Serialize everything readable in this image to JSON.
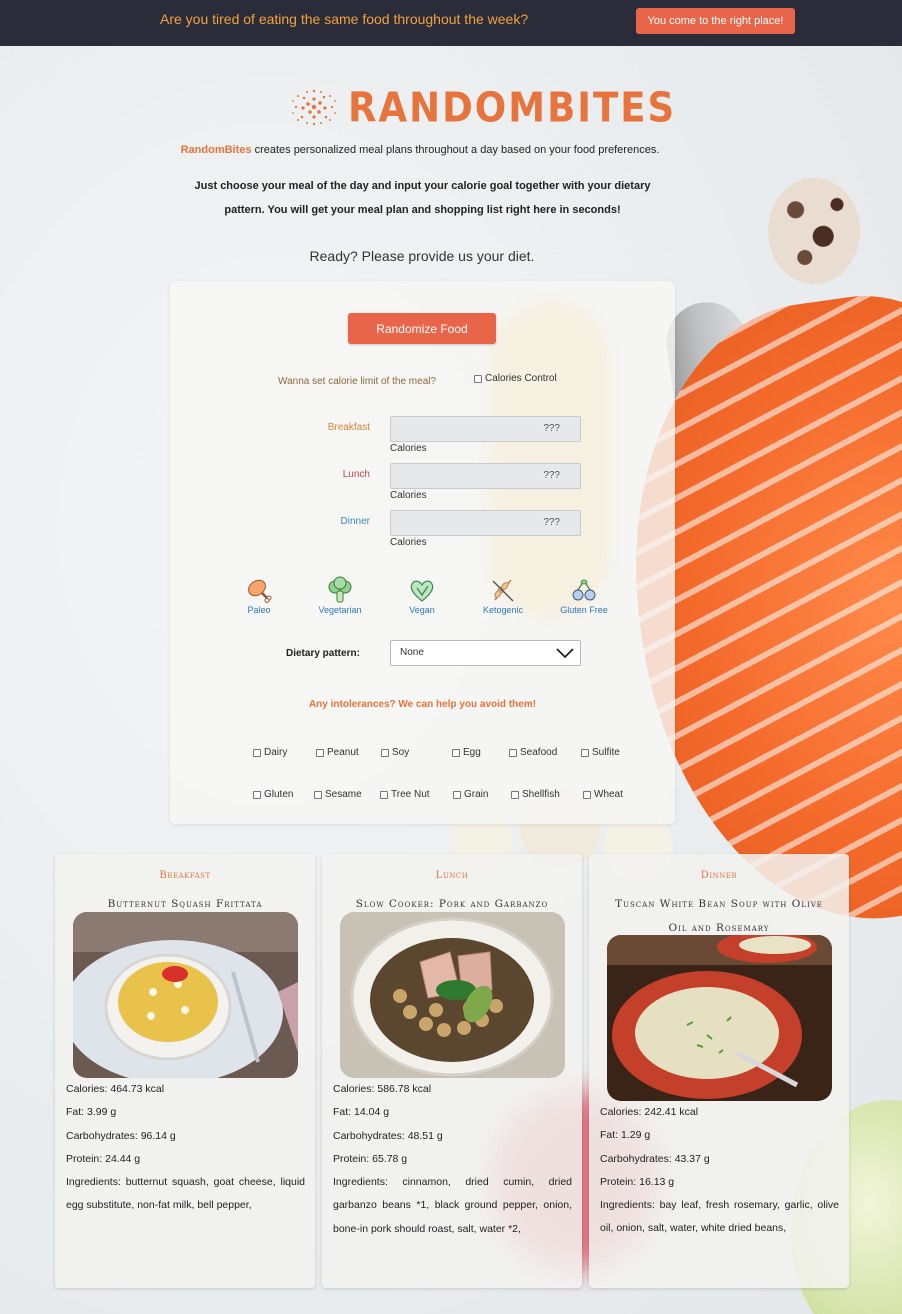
{
  "topbar": {
    "question": "Are you tired of eating the same food throughout the week?",
    "cta_label": "You come to the right place!"
  },
  "brand": {
    "logo_text": "RANDOMBITES",
    "name": "RandomBites",
    "accent": "#e6743c"
  },
  "intro": {
    "line1_rest": "creates personalized meal plans throughout a day based on your food preferences.",
    "line2": "Just choose your meal of the day and input your calorie goal together with your dietary pattern. You will get your meal plan and shopping list right here in seconds!",
    "ready": "Ready? Please provide us your diet."
  },
  "form": {
    "randomize_label": "Randomize Food",
    "calorie_question": "Wanna set calorie limit of the meal?",
    "calorie_control_label": "Calories Control",
    "meals": [
      {
        "label": "Breakfast",
        "value": "???",
        "unit": "Calories",
        "color": "#d8873a"
      },
      {
        "label": "Lunch",
        "value": "???",
        "unit": "Calories",
        "color": "#b84a4a"
      },
      {
        "label": "Dinner",
        "value": "???",
        "unit": "Calories",
        "color": "#3a87c8"
      }
    ],
    "diets": [
      {
        "label": "Paleo",
        "icon": "drumstick-icon"
      },
      {
        "label": "Vegetarian",
        "icon": "broccoli-icon"
      },
      {
        "label": "Vegan",
        "icon": "heart-leaf-icon"
      },
      {
        "label": "Ketogenic",
        "icon": "no-wheat-icon"
      },
      {
        "label": "Gluten Free",
        "icon": "grains-icon"
      }
    ],
    "dietary_pattern_label": "Dietary pattern:",
    "dietary_pattern_value": "None",
    "intolerance_question": "Any intolerances? We can help you avoid them!",
    "intolerances": [
      "Dairy",
      "Peanut",
      "Soy",
      "Egg",
      "Seafood",
      "Sulfite",
      "Gluten",
      "Sesame",
      "Tree Nut",
      "Grain",
      "Shellfish",
      "Wheat"
    ]
  },
  "results": [
    {
      "meal": "Breakfast",
      "title": "Butternut Squash Frittata",
      "calories": "Calories: 464.73 kcal",
      "fat": "Fat: 3.99 g",
      "carbs": "Carbohydrates: 96.14 g",
      "protein": "Protein: 24.44 g",
      "ingredients": "Ingredients: butternut squash, goat cheese, liquid egg substitute, non-fat milk, bell pepper,"
    },
    {
      "meal": "Lunch",
      "title": "Slow Cooker: Pork and Garbanzo Beans",
      "calories": "Calories: 586.78 kcal",
      "fat": "Fat: 14.04 g",
      "carbs": "Carbohydrates: 48.51 g",
      "protein": "Protein: 65.78 g",
      "ingredients": "Ingredients: cinnamon, dried cumin, dried garbanzo beans *1, black ground pepper, onion, bone-in pork should roast, salt, water *2,"
    },
    {
      "meal": "Dinner",
      "title": "Tuscan White Bean Soup with Olive Oil and Rosemary",
      "calories": "Calories: 242.41 kcal",
      "fat": "Fat: 1.29 g",
      "carbs": "Carbohydrates: 43.37 g",
      "protein": "Protein: 16.13 g",
      "ingredients": "Ingredients: bay leaf, fresh rosemary, garlic, olive oil, onion, salt, water, white dried beans,"
    }
  ]
}
